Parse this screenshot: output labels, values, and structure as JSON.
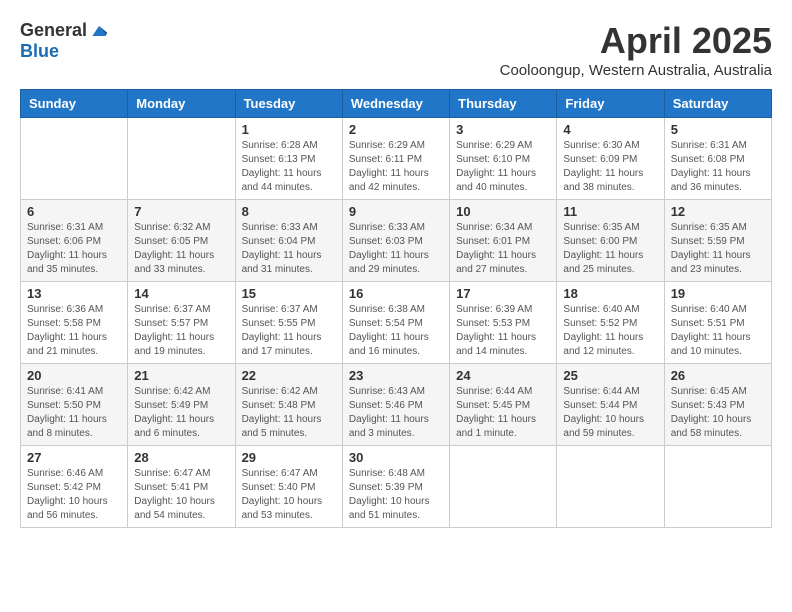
{
  "logo": {
    "general": "General",
    "blue": "Blue"
  },
  "title": "April 2025",
  "subtitle": "Cooloongup, Western Australia, Australia",
  "days_of_week": [
    "Sunday",
    "Monday",
    "Tuesday",
    "Wednesday",
    "Thursday",
    "Friday",
    "Saturday"
  ],
  "weeks": [
    [
      {
        "day": "",
        "sunrise": "",
        "sunset": "",
        "daylight": ""
      },
      {
        "day": "",
        "sunrise": "",
        "sunset": "",
        "daylight": ""
      },
      {
        "day": "1",
        "sunrise": "Sunrise: 6:28 AM",
        "sunset": "Sunset: 6:13 PM",
        "daylight": "Daylight: 11 hours and 44 minutes."
      },
      {
        "day": "2",
        "sunrise": "Sunrise: 6:29 AM",
        "sunset": "Sunset: 6:11 PM",
        "daylight": "Daylight: 11 hours and 42 minutes."
      },
      {
        "day": "3",
        "sunrise": "Sunrise: 6:29 AM",
        "sunset": "Sunset: 6:10 PM",
        "daylight": "Daylight: 11 hours and 40 minutes."
      },
      {
        "day": "4",
        "sunrise": "Sunrise: 6:30 AM",
        "sunset": "Sunset: 6:09 PM",
        "daylight": "Daylight: 11 hours and 38 minutes."
      },
      {
        "day": "5",
        "sunrise": "Sunrise: 6:31 AM",
        "sunset": "Sunset: 6:08 PM",
        "daylight": "Daylight: 11 hours and 36 minutes."
      }
    ],
    [
      {
        "day": "6",
        "sunrise": "Sunrise: 6:31 AM",
        "sunset": "Sunset: 6:06 PM",
        "daylight": "Daylight: 11 hours and 35 minutes."
      },
      {
        "day": "7",
        "sunrise": "Sunrise: 6:32 AM",
        "sunset": "Sunset: 6:05 PM",
        "daylight": "Daylight: 11 hours and 33 minutes."
      },
      {
        "day": "8",
        "sunrise": "Sunrise: 6:33 AM",
        "sunset": "Sunset: 6:04 PM",
        "daylight": "Daylight: 11 hours and 31 minutes."
      },
      {
        "day": "9",
        "sunrise": "Sunrise: 6:33 AM",
        "sunset": "Sunset: 6:03 PM",
        "daylight": "Daylight: 11 hours and 29 minutes."
      },
      {
        "day": "10",
        "sunrise": "Sunrise: 6:34 AM",
        "sunset": "Sunset: 6:01 PM",
        "daylight": "Daylight: 11 hours and 27 minutes."
      },
      {
        "day": "11",
        "sunrise": "Sunrise: 6:35 AM",
        "sunset": "Sunset: 6:00 PM",
        "daylight": "Daylight: 11 hours and 25 minutes."
      },
      {
        "day": "12",
        "sunrise": "Sunrise: 6:35 AM",
        "sunset": "Sunset: 5:59 PM",
        "daylight": "Daylight: 11 hours and 23 minutes."
      }
    ],
    [
      {
        "day": "13",
        "sunrise": "Sunrise: 6:36 AM",
        "sunset": "Sunset: 5:58 PM",
        "daylight": "Daylight: 11 hours and 21 minutes."
      },
      {
        "day": "14",
        "sunrise": "Sunrise: 6:37 AM",
        "sunset": "Sunset: 5:57 PM",
        "daylight": "Daylight: 11 hours and 19 minutes."
      },
      {
        "day": "15",
        "sunrise": "Sunrise: 6:37 AM",
        "sunset": "Sunset: 5:55 PM",
        "daylight": "Daylight: 11 hours and 17 minutes."
      },
      {
        "day": "16",
        "sunrise": "Sunrise: 6:38 AM",
        "sunset": "Sunset: 5:54 PM",
        "daylight": "Daylight: 11 hours and 16 minutes."
      },
      {
        "day": "17",
        "sunrise": "Sunrise: 6:39 AM",
        "sunset": "Sunset: 5:53 PM",
        "daylight": "Daylight: 11 hours and 14 minutes."
      },
      {
        "day": "18",
        "sunrise": "Sunrise: 6:40 AM",
        "sunset": "Sunset: 5:52 PM",
        "daylight": "Daylight: 11 hours and 12 minutes."
      },
      {
        "day": "19",
        "sunrise": "Sunrise: 6:40 AM",
        "sunset": "Sunset: 5:51 PM",
        "daylight": "Daylight: 11 hours and 10 minutes."
      }
    ],
    [
      {
        "day": "20",
        "sunrise": "Sunrise: 6:41 AM",
        "sunset": "Sunset: 5:50 PM",
        "daylight": "Daylight: 11 hours and 8 minutes."
      },
      {
        "day": "21",
        "sunrise": "Sunrise: 6:42 AM",
        "sunset": "Sunset: 5:49 PM",
        "daylight": "Daylight: 11 hours and 6 minutes."
      },
      {
        "day": "22",
        "sunrise": "Sunrise: 6:42 AM",
        "sunset": "Sunset: 5:48 PM",
        "daylight": "Daylight: 11 hours and 5 minutes."
      },
      {
        "day": "23",
        "sunrise": "Sunrise: 6:43 AM",
        "sunset": "Sunset: 5:46 PM",
        "daylight": "Daylight: 11 hours and 3 minutes."
      },
      {
        "day": "24",
        "sunrise": "Sunrise: 6:44 AM",
        "sunset": "Sunset: 5:45 PM",
        "daylight": "Daylight: 11 hours and 1 minute."
      },
      {
        "day": "25",
        "sunrise": "Sunrise: 6:44 AM",
        "sunset": "Sunset: 5:44 PM",
        "daylight": "Daylight: 10 hours and 59 minutes."
      },
      {
        "day": "26",
        "sunrise": "Sunrise: 6:45 AM",
        "sunset": "Sunset: 5:43 PM",
        "daylight": "Daylight: 10 hours and 58 minutes."
      }
    ],
    [
      {
        "day": "27",
        "sunrise": "Sunrise: 6:46 AM",
        "sunset": "Sunset: 5:42 PM",
        "daylight": "Daylight: 10 hours and 56 minutes."
      },
      {
        "day": "28",
        "sunrise": "Sunrise: 6:47 AM",
        "sunset": "Sunset: 5:41 PM",
        "daylight": "Daylight: 10 hours and 54 minutes."
      },
      {
        "day": "29",
        "sunrise": "Sunrise: 6:47 AM",
        "sunset": "Sunset: 5:40 PM",
        "daylight": "Daylight: 10 hours and 53 minutes."
      },
      {
        "day": "30",
        "sunrise": "Sunrise: 6:48 AM",
        "sunset": "Sunset: 5:39 PM",
        "daylight": "Daylight: 10 hours and 51 minutes."
      },
      {
        "day": "",
        "sunrise": "",
        "sunset": "",
        "daylight": ""
      },
      {
        "day": "",
        "sunrise": "",
        "sunset": "",
        "daylight": ""
      },
      {
        "day": "",
        "sunrise": "",
        "sunset": "",
        "daylight": ""
      }
    ]
  ]
}
